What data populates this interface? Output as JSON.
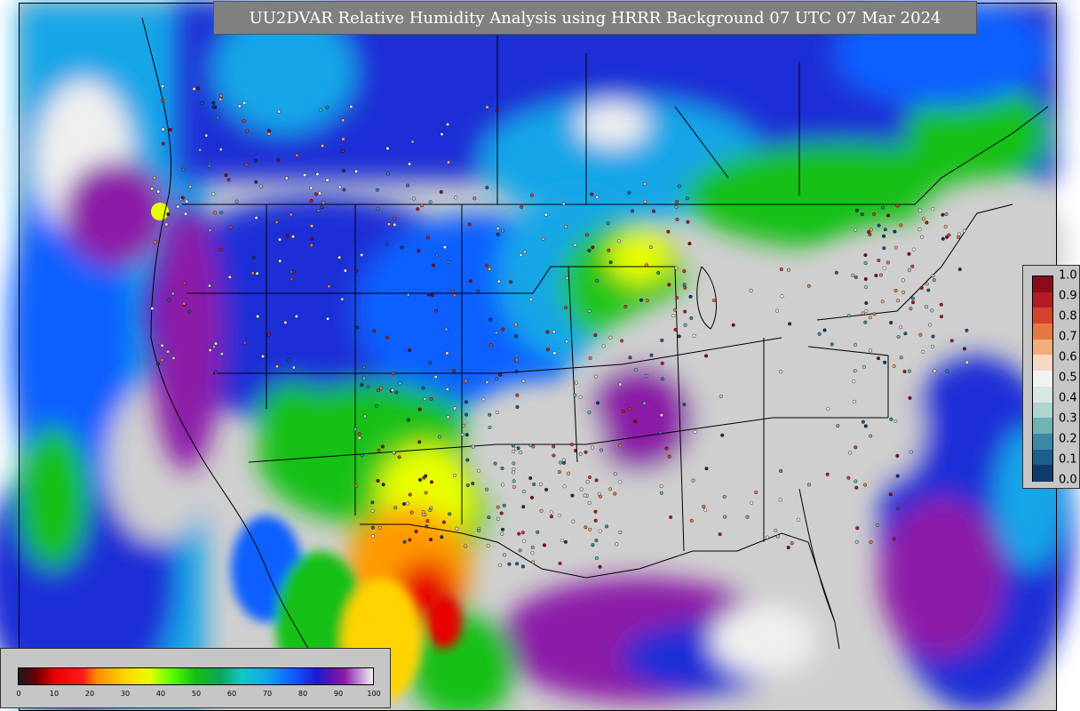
{
  "title": "UU2DVAR Relative Humidity Analysis using HRRR Background 07 UTC 07 Mar 2024",
  "colors": {
    "ocean_land_dry": "#cfcfcf",
    "moist_blue": "#1a2fd6",
    "cyan": "#12a6e8",
    "green": "#22c41a",
    "yellow": "#ffe000",
    "orange": "#ff9a00",
    "red": "#e80000",
    "purple": "#8c1aa8",
    "white_moist": "#f0f0f0",
    "border_line": "#000000"
  },
  "rh_colorbar": {
    "ticks": [
      "0",
      "10",
      "20",
      "30",
      "40",
      "50",
      "60",
      "70",
      "80",
      "90",
      "100"
    ],
    "stops": [
      {
        "value": 0,
        "color": "#1a1a1a"
      },
      {
        "value": 5,
        "color": "#6e0000"
      },
      {
        "value": 10,
        "color": "#e80000"
      },
      {
        "value": 18,
        "color": "#ff1a1a"
      },
      {
        "value": 22,
        "color": "#ff8c00"
      },
      {
        "value": 30,
        "color": "#ffd400"
      },
      {
        "value": 37,
        "color": "#e8ff00"
      },
      {
        "value": 43,
        "color": "#5cff00"
      },
      {
        "value": 50,
        "color": "#12c012"
      },
      {
        "value": 57,
        "color": "#0fa55a"
      },
      {
        "value": 63,
        "color": "#10c8c8"
      },
      {
        "value": 70,
        "color": "#12a6e8"
      },
      {
        "value": 77,
        "color": "#1060ff"
      },
      {
        "value": 84,
        "color": "#1a1ad6"
      },
      {
        "value": 88,
        "color": "#5a14b4"
      },
      {
        "value": 92,
        "color": "#8c1aa8"
      },
      {
        "value": 95,
        "color": "#b46ec8"
      },
      {
        "value": 100,
        "color": "#f2f2f2"
      }
    ]
  },
  "obs_colorbar": {
    "ticks": [
      "1.0",
      "0.9",
      "0.8",
      "0.7",
      "0.6",
      "0.5",
      "0.4",
      "0.3",
      "0.2",
      "0.1",
      "0.0"
    ],
    "bands": [
      "#8b0b1c",
      "#b31c26",
      "#d2422f",
      "#e7783f",
      "#f1ad7b",
      "#f8d7c6",
      "#f2f2f2",
      "#d8e6e4",
      "#aed3d0",
      "#6fb3b5",
      "#3a88a3",
      "#1e5d8c",
      "#0f3a6a"
    ]
  }
}
